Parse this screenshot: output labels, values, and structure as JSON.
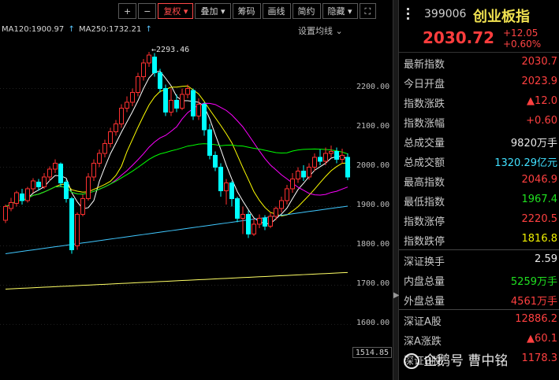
{
  "toolbar": {
    "items": [
      {
        "label": "+",
        "name": "zoom-in-button"
      },
      {
        "label": "−",
        "name": "zoom-out-button"
      },
      {
        "label": "复权 ▾",
        "name": "fuquan-dropdown",
        "active": true
      },
      {
        "label": "叠加 ▾",
        "name": "overlay-dropdown"
      },
      {
        "label": "筹码",
        "name": "chips-button"
      },
      {
        "label": "画线",
        "name": "draw-line-button"
      },
      {
        "label": "简约",
        "name": "simple-mode-button"
      },
      {
        "label": "隐藏 ▾",
        "name": "hide-dropdown"
      },
      {
        "label": "⛶",
        "name": "fullscreen-button"
      }
    ]
  },
  "ma_legend": {
    "ma120": "MA120:1900.97",
    "ma250": "MA250:1732.21",
    "arrow": "↑"
  },
  "settings_label": "设置均线",
  "y_axis": {
    "ticks": [
      "2200.00",
      "2100.00",
      "2000.00",
      "1900.00",
      "1800.00",
      "1700.00",
      "1600.00"
    ],
    "cursor_value": "1514.85"
  },
  "peak_label": "2293.46",
  "chart_data": {
    "type": "candlestick",
    "peak": 2293.46,
    "ylim": [
      1514.85,
      2325
    ],
    "colors": {
      "up": "#ff3030",
      "down": "#00ffff",
      "ma5": "#ffffff",
      "ma10": "#ffff00",
      "ma20": "#ff00ff",
      "ma60": "#00ff00",
      "ma120": "#40c8ff",
      "ma250": "#ffff66"
    },
    "candles": [
      [
        1865,
        1900,
        1858,
        1905
      ],
      [
        1895,
        1910,
        1888,
        1922
      ],
      [
        1908,
        1935,
        1900,
        1940
      ],
      [
        1932,
        1915,
        1905,
        1945
      ],
      [
        1915,
        1945,
        1910,
        1950
      ],
      [
        1945,
        1965,
        1935,
        1972
      ],
      [
        1962,
        1950,
        1940,
        1970
      ],
      [
        1950,
        1975,
        1945,
        1985
      ],
      [
        1975,
        1995,
        1965,
        2002
      ],
      [
        1995,
        2010,
        1985,
        2020
      ],
      [
        2008,
        1960,
        1950,
        2012
      ],
      [
        1962,
        1920,
        1910,
        1968
      ],
      [
        1920,
        1790,
        1780,
        1925
      ],
      [
        1800,
        1880,
        1790,
        1885
      ],
      [
        1880,
        1920,
        1875,
        1930
      ],
      [
        1920,
        1975,
        1915,
        1985
      ],
      [
        1975,
        2010,
        1965,
        2020
      ],
      [
        2010,
        2035,
        2000,
        2045
      ],
      [
        2035,
        2060,
        2025,
        2070
      ],
      [
        2060,
        2090,
        2050,
        2100
      ],
      [
        2090,
        2110,
        2080,
        2120
      ],
      [
        2110,
        2150,
        2100,
        2160
      ],
      [
        2150,
        2165,
        2140,
        2180
      ],
      [
        2165,
        2190,
        2155,
        2200
      ],
      [
        2190,
        2230,
        2180,
        2240
      ],
      [
        2230,
        2265,
        2220,
        2275
      ],
      [
        2265,
        2285,
        2255,
        2293
      ],
      [
        2280,
        2240,
        2230,
        2290
      ],
      [
        2240,
        2200,
        2190,
        2250
      ],
      [
        2200,
        2140,
        2130,
        2210
      ],
      [
        2140,
        2170,
        2130,
        2200
      ],
      [
        2170,
        2150,
        2140,
        2185
      ],
      [
        2150,
        2185,
        2145,
        2200
      ],
      [
        2185,
        2200,
        2175,
        2210
      ],
      [
        2195,
        2130,
        2120,
        2200
      ],
      [
        2130,
        2160,
        2120,
        2175
      ],
      [
        2160,
        2095,
        2080,
        2165
      ],
      [
        2095,
        2030,
        2020,
        2110
      ],
      [
        2030,
        2000,
        1990,
        2040
      ],
      [
        2000,
        1940,
        1925,
        2010
      ],
      [
        1940,
        1960,
        1905,
        1970
      ],
      [
        1960,
        1920,
        1900,
        1965
      ],
      [
        1920,
        1870,
        1860,
        1925
      ],
      [
        1870,
        1880,
        1830,
        1900
      ],
      [
        1880,
        1830,
        1820,
        1890
      ],
      [
        1830,
        1855,
        1825,
        1870
      ],
      [
        1855,
        1870,
        1845,
        1880
      ],
      [
        1870,
        1850,
        1840,
        1878
      ],
      [
        1850,
        1875,
        1845,
        1885
      ],
      [
        1875,
        1895,
        1865,
        1900
      ],
      [
        1895,
        1915,
        1885,
        1925
      ],
      [
        1915,
        1945,
        1905,
        1955
      ],
      [
        1945,
        1970,
        1935,
        1985
      ],
      [
        1970,
        1990,
        1960,
        2000
      ],
      [
        1990,
        1975,
        1965,
        2005
      ],
      [
        1975,
        2000,
        1968,
        2010
      ],
      [
        2000,
        2025,
        1990,
        2035
      ],
      [
        2025,
        2015,
        2005,
        2045
      ],
      [
        2015,
        2035,
        2005,
        2050
      ],
      [
        2035,
        2040,
        2025,
        2055
      ],
      [
        2040,
        2020,
        2010,
        2050
      ],
      [
        2020,
        2030,
        2010,
        2047
      ],
      [
        2025,
        1975,
        1967,
        2035
      ]
    ]
  },
  "panel": {
    "code": "399006",
    "name": "创业板指",
    "price": "2030.72",
    "change": "+12.05",
    "change_pct": "+0.60%",
    "rows": [
      {
        "label": "最新指数",
        "value": "2030.7",
        "color": "red",
        "sep": false
      },
      {
        "label": "今日开盘",
        "value": "2023.9",
        "color": "red",
        "sep": false
      },
      {
        "label": "指数涨跌",
        "value": "▲12.0",
        "color": "red",
        "sep": false
      },
      {
        "label": "指数涨幅",
        "value": "+0.60",
        "color": "red",
        "sep": false
      },
      {
        "label": "总成交量",
        "value": "9820万手",
        "color": "white",
        "sep": false
      },
      {
        "label": "总成交额",
        "value": "1320.29亿元",
        "color": "cyan",
        "sep": false
      },
      {
        "label": "最高指数",
        "value": "2046.9",
        "color": "red",
        "sep": false
      },
      {
        "label": "最低指数",
        "value": "1967.4",
        "color": "green",
        "sep": false
      },
      {
        "label": "指数涨停",
        "value": "2220.5",
        "color": "red",
        "sep": false
      },
      {
        "label": "指数跌停",
        "value": "1816.8",
        "color": "yellow",
        "sep": false
      },
      {
        "label": "深证换手",
        "value": "2.59",
        "color": "white",
        "sep": true
      },
      {
        "label": "内盘总量",
        "value": "5259万手",
        "color": "green",
        "sep": false
      },
      {
        "label": "外盘总量",
        "value": "4561万手",
        "color": "red",
        "sep": false
      },
      {
        "label": "深证A股",
        "value": "12886.2",
        "color": "red",
        "sep": true
      },
      {
        "label": "深A涨跌",
        "value": "▲60.1",
        "color": "red",
        "sep": false
      },
      {
        "label": "深证B股",
        "value": "1178.3",
        "color": "red",
        "sep": false
      }
    ]
  },
  "watermark": "企鹅号 曹中铭"
}
